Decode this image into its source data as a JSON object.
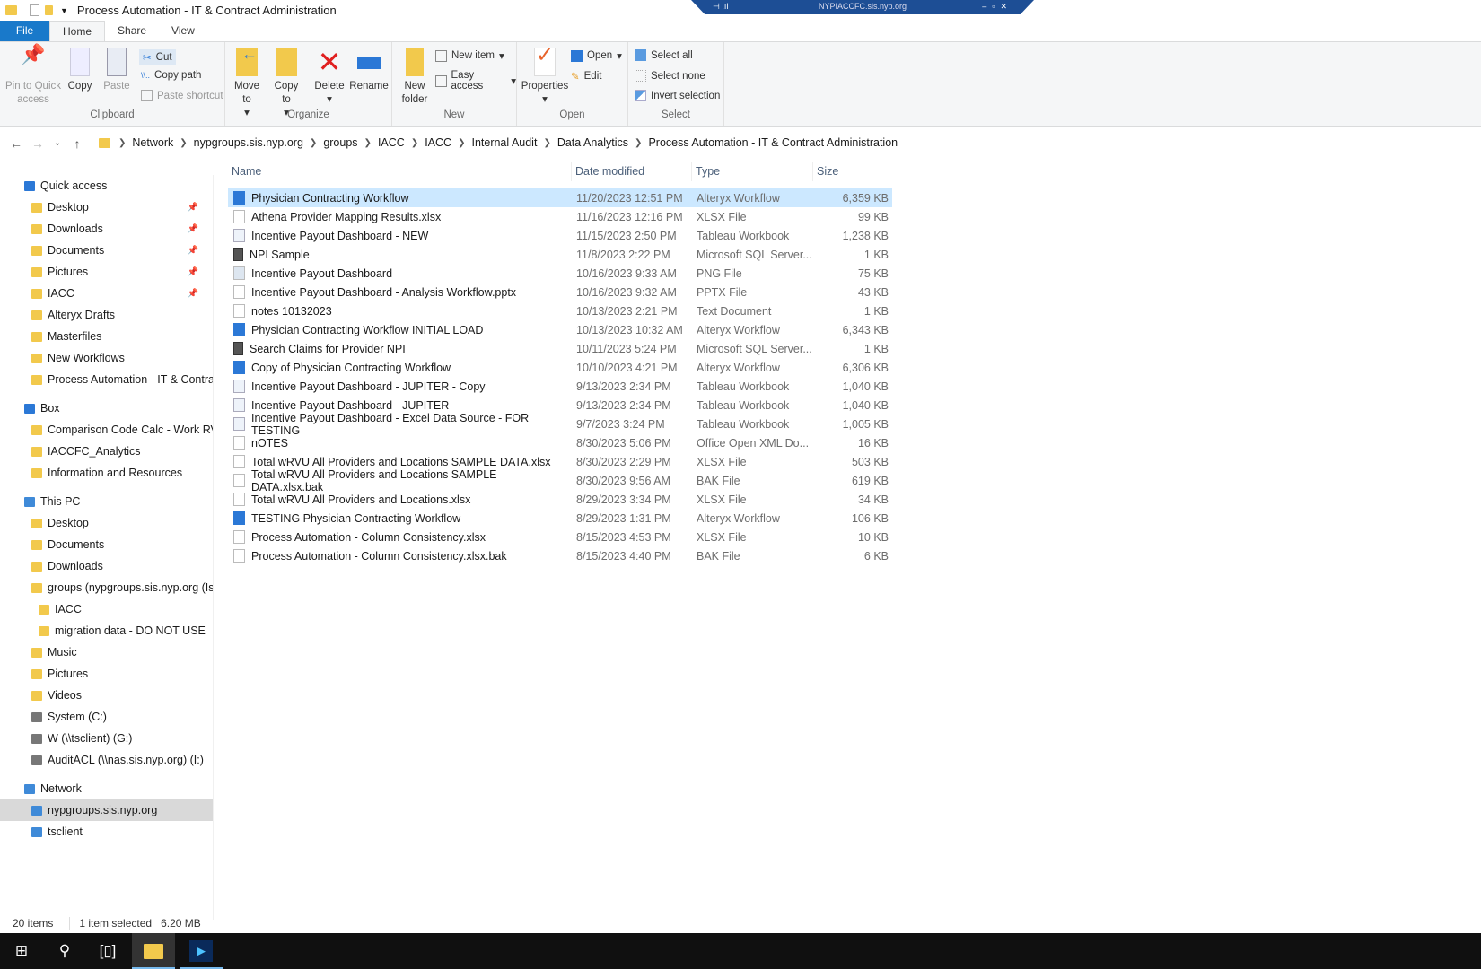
{
  "window": {
    "title": "Process Automation - IT & Contract Administration",
    "rdp_host": "NYPIACCFC.sis.nyp.org"
  },
  "tabs": [
    "File",
    "Home",
    "Share",
    "View"
  ],
  "ribbon": {
    "clipboard": {
      "label": "Clipboard",
      "pin": "Pin to Quick access",
      "copy": "Copy",
      "paste": "Paste",
      "cut": "Cut",
      "copy_path": "Copy path",
      "paste_shortcut": "Paste shortcut"
    },
    "organize": {
      "label": "Organize",
      "move_to": "Move to",
      "copy_to": "Copy to",
      "delete": "Delete",
      "rename": "Rename"
    },
    "new": {
      "label": "New",
      "new_folder": "New folder",
      "new_item": "New item",
      "easy_access": "Easy access"
    },
    "open": {
      "label": "Open",
      "properties": "Properties",
      "open": "Open",
      "edit": "Edit"
    },
    "select": {
      "label": "Select",
      "select_all": "Select all",
      "select_none": "Select none",
      "invert": "Invert selection"
    }
  },
  "breadcrumb": [
    "Network",
    "nypgroups.sis.nyp.org",
    "groups",
    "IACC",
    "IACC",
    "Internal Audit",
    "Data Analytics",
    "Process Automation - IT & Contract Administration"
  ],
  "nav": {
    "quick_access": "Quick access",
    "quick_items": [
      "Desktop",
      "Downloads",
      "Documents",
      "Pictures",
      "IACC",
      "Alteryx Drafts",
      "Masterfiles",
      "New Workflows",
      "Process Automation - IT & Contract Administration"
    ],
    "box": "Box",
    "box_items": [
      "Comparison Code Calc - Work RVU",
      "IACCFC_Analytics",
      "Information and Resources"
    ],
    "this_pc": "This PC",
    "pc_items": [
      "Desktop",
      "Documents",
      "Downloads",
      "groups (nypgroups.sis.nyp.org (Isilon))",
      "IACC",
      "migration data - DO NOT USE",
      "Music",
      "Pictures",
      "Videos",
      "System (C:)",
      "W (\\\\tsclient) (G:)",
      "AuditACL (\\\\nas.sis.nyp.org) (I:)"
    ],
    "network": "Network",
    "network_items": [
      "nypgroups.sis.nyp.org",
      "tsclient"
    ]
  },
  "columns": [
    "Name",
    "Date modified",
    "Type",
    "Size"
  ],
  "files": [
    {
      "name": "Physician Contracting Workflow",
      "date": "11/20/2023 12:51 PM",
      "type": "Alteryx Workflow",
      "size": "6,359 KB",
      "icon": "alteryx"
    },
    {
      "name": "Athena Provider Mapping Results.xlsx",
      "date": "11/16/2023 12:16 PM",
      "type": "XLSX File",
      "size": "99 KB",
      "icon": "file"
    },
    {
      "name": "Incentive Payout Dashboard - NEW",
      "date": "11/15/2023 2:50 PM",
      "type": "Tableau Workbook",
      "size": "1,238 KB",
      "icon": "tableau"
    },
    {
      "name": "NPI Sample",
      "date": "11/8/2023 2:22 PM",
      "type": "Microsoft SQL Server...",
      "size": "1 KB",
      "icon": "sql"
    },
    {
      "name": "Incentive Payout Dashboard",
      "date": "10/16/2023 9:33 AM",
      "type": "PNG File",
      "size": "75 KB",
      "icon": "png"
    },
    {
      "name": "Incentive Payout Dashboard - Analysis Workflow.pptx",
      "date": "10/16/2023 9:32 AM",
      "type": "PPTX File",
      "size": "43 KB",
      "icon": "file"
    },
    {
      "name": "notes 10132023",
      "date": "10/13/2023 2:21 PM",
      "type": "Text Document",
      "size": "1 KB",
      "icon": "file"
    },
    {
      "name": "Physician Contracting Workflow INITIAL LOAD",
      "date": "10/13/2023 10:32 AM",
      "type": "Alteryx Workflow",
      "size": "6,343 KB",
      "icon": "alteryx"
    },
    {
      "name": "Search Claims for Provider NPI",
      "date": "10/11/2023 5:24 PM",
      "type": "Microsoft SQL Server...",
      "size": "1 KB",
      "icon": "sql"
    },
    {
      "name": "Copy of Physician Contracting Workflow",
      "date": "10/10/2023 4:21 PM",
      "type": "Alteryx Workflow",
      "size": "6,306 KB",
      "icon": "alteryx"
    },
    {
      "name": "Incentive Payout Dashboard - JUPITER - Copy",
      "date": "9/13/2023 2:34 PM",
      "type": "Tableau Workbook",
      "size": "1,040 KB",
      "icon": "tableau"
    },
    {
      "name": "Incentive Payout Dashboard - JUPITER",
      "date": "9/13/2023 2:34 PM",
      "type": "Tableau Workbook",
      "size": "1,040 KB",
      "icon": "tableau"
    },
    {
      "name": "Incentive Payout Dashboard - Excel Data Source - FOR TESTING",
      "date": "9/7/2023 3:24 PM",
      "type": "Tableau Workbook",
      "size": "1,005 KB",
      "icon": "tableau"
    },
    {
      "name": "nOTES",
      "date": "8/30/2023 5:06 PM",
      "type": "Office Open XML Do...",
      "size": "16 KB",
      "icon": "file"
    },
    {
      "name": "Total wRVU All Providers and Locations SAMPLE DATA.xlsx",
      "date": "8/30/2023 2:29 PM",
      "type": "XLSX File",
      "size": "503 KB",
      "icon": "file"
    },
    {
      "name": "Total wRVU All Providers and Locations SAMPLE DATA.xlsx.bak",
      "date": "8/30/2023 9:56 AM",
      "type": "BAK File",
      "size": "619 KB",
      "icon": "file"
    },
    {
      "name": "Total wRVU All Providers and Locations.xlsx",
      "date": "8/29/2023 3:34 PM",
      "type": "XLSX File",
      "size": "34 KB",
      "icon": "file"
    },
    {
      "name": "TESTING Physician Contracting Workflow",
      "date": "8/29/2023 1:31 PM",
      "type": "Alteryx Workflow",
      "size": "106 KB",
      "icon": "alteryx"
    },
    {
      "name": "Process Automation - Column Consistency.xlsx",
      "date": "8/15/2023 4:53 PM",
      "type": "XLSX File",
      "size": "10 KB",
      "icon": "file"
    },
    {
      "name": "Process Automation - Column Consistency.xlsx.bak",
      "date": "8/15/2023 4:40 PM",
      "type": "BAK File",
      "size": "6 KB",
      "icon": "file"
    }
  ],
  "status": {
    "count": "20 items",
    "selected": "1 item selected",
    "size": "6.20 MB"
  },
  "colors": {
    "accent": "#1979ca",
    "selection": "#cce8ff",
    "taskbar": "#101010"
  }
}
